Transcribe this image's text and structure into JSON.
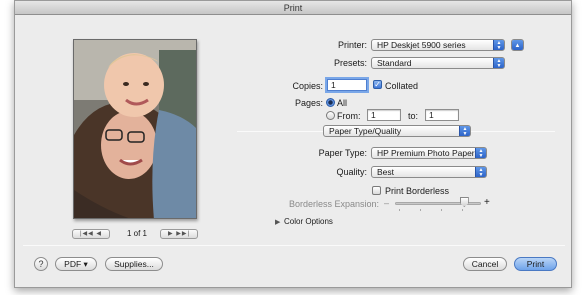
{
  "window": {
    "title": "Print"
  },
  "preview": {
    "page_indicator": "1 of 1",
    "first_prev": "|◀◀  ◀",
    "next_last": "▶  ▶▶|"
  },
  "printer": {
    "label": "Printer:",
    "value": "HP Deskjet 5900 series"
  },
  "presets": {
    "label": "Presets:",
    "value": "Standard"
  },
  "copies": {
    "label": "Copies:",
    "value": "1",
    "collated_label": "Collated",
    "collated_checked": true
  },
  "pages": {
    "label": "Pages:",
    "all_label": "All",
    "from_label": "From:",
    "from_value": "1",
    "to_label": "to:",
    "to_value": "1",
    "selected": "All"
  },
  "section": {
    "value": "Paper Type/Quality"
  },
  "paper_type": {
    "label": "Paper Type:",
    "value": "HP Premium Photo Paper"
  },
  "quality": {
    "label": "Quality:",
    "value": "Best"
  },
  "borderless": {
    "checkbox_label": "Print Borderless",
    "checked": false,
    "expansion_label": "Borderless Expansion:",
    "minus": "–",
    "plus": "+",
    "level": 0.8
  },
  "color_options": {
    "label": "Color Options"
  },
  "footer": {
    "help": "?",
    "pdf": "PDF ▾",
    "supplies": "Supplies...",
    "cancel": "Cancel",
    "print": "Print"
  },
  "colors": {
    "accent": "#3f77d8",
    "window_bg": "#ececec"
  }
}
